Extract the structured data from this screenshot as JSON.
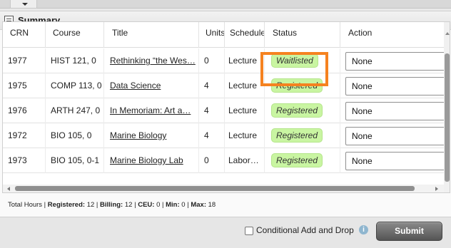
{
  "panel": {
    "title": "Summary"
  },
  "table": {
    "headers": [
      "CRN",
      "Course",
      "Title",
      "Units",
      "Schedule",
      "Status",
      "Action"
    ],
    "rows": [
      {
        "crn": "1977",
        "course": "HIST 121, 0",
        "title": "Rethinking “the Wes…",
        "units": "0",
        "schedule": "Lecture",
        "status": "Waitlisted",
        "action": "None"
      },
      {
        "crn": "1975",
        "course": "COMP 113, 0",
        "title": "Data Science",
        "units": "4",
        "schedule": "Lecture",
        "status": "Registered",
        "action": "None"
      },
      {
        "crn": "1976",
        "course": "ARTH 247, 0",
        "title": "In Memoriam: Art a…",
        "units": "4",
        "schedule": "Lecture",
        "status": "Registered",
        "action": "None"
      },
      {
        "crn": "1972",
        "course": "BIO 105, 0",
        "title": "Marine Biology",
        "units": "4",
        "schedule": "Lecture",
        "status": "Registered",
        "action": "None"
      },
      {
        "crn": "1973",
        "course": "BIO 105, 0-1",
        "title": "Marine Biology Lab",
        "units": "0",
        "schedule": "Labor…",
        "status": "Registered",
        "action": "None"
      }
    ]
  },
  "totals": {
    "prefix": "Total Hours | ",
    "registered_label": "Registered:",
    "registered": "12",
    "billing_label": "Billing:",
    "billing": "12",
    "ceu_label": "CEU:",
    "ceu": "0",
    "min_label": "Min:",
    "min": "0",
    "max_label": "Max:",
    "max": "18"
  },
  "footer": {
    "conditional_label": "Conditional Add and Drop",
    "info_glyph": "i",
    "submit_label": "Submit"
  },
  "colors": {
    "highlight": "#f58220",
    "status_badge": "#c9f5a2",
    "submit": "#666666"
  },
  "icons": [
    "summary-icon",
    "dropdown-caret-icon",
    "info-icon"
  ]
}
